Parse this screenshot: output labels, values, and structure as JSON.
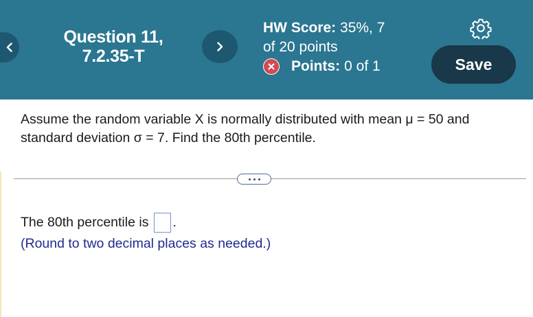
{
  "header": {
    "question_line1": "Question 11,",
    "question_line2": "7.2.35-T",
    "hw_score_label": "HW Score:",
    "hw_score_value": "35%, 7",
    "hw_score_line2": "of 20 points",
    "points_label": "Points:",
    "points_value": "0 of 1",
    "save_label": "Save",
    "icons": {
      "back": "chevron-left-icon",
      "next": "chevron-right-icon",
      "settings": "gear-icon",
      "incorrect": "x-circle-icon"
    },
    "colors": {
      "header_bg": "#2b7691",
      "save_bg": "#19384a",
      "incorrect": "#d14b54"
    }
  },
  "question": {
    "text": "Assume the random variable X is normally distributed with mean μ = 50 and standard deviation σ = 7. Find the 80th percentile."
  },
  "more_button_label": "• • •",
  "answer": {
    "prefix": "The 80th percentile is",
    "value": "",
    "suffix": ".",
    "hint": "(Round to two decimal places as needed.)"
  }
}
